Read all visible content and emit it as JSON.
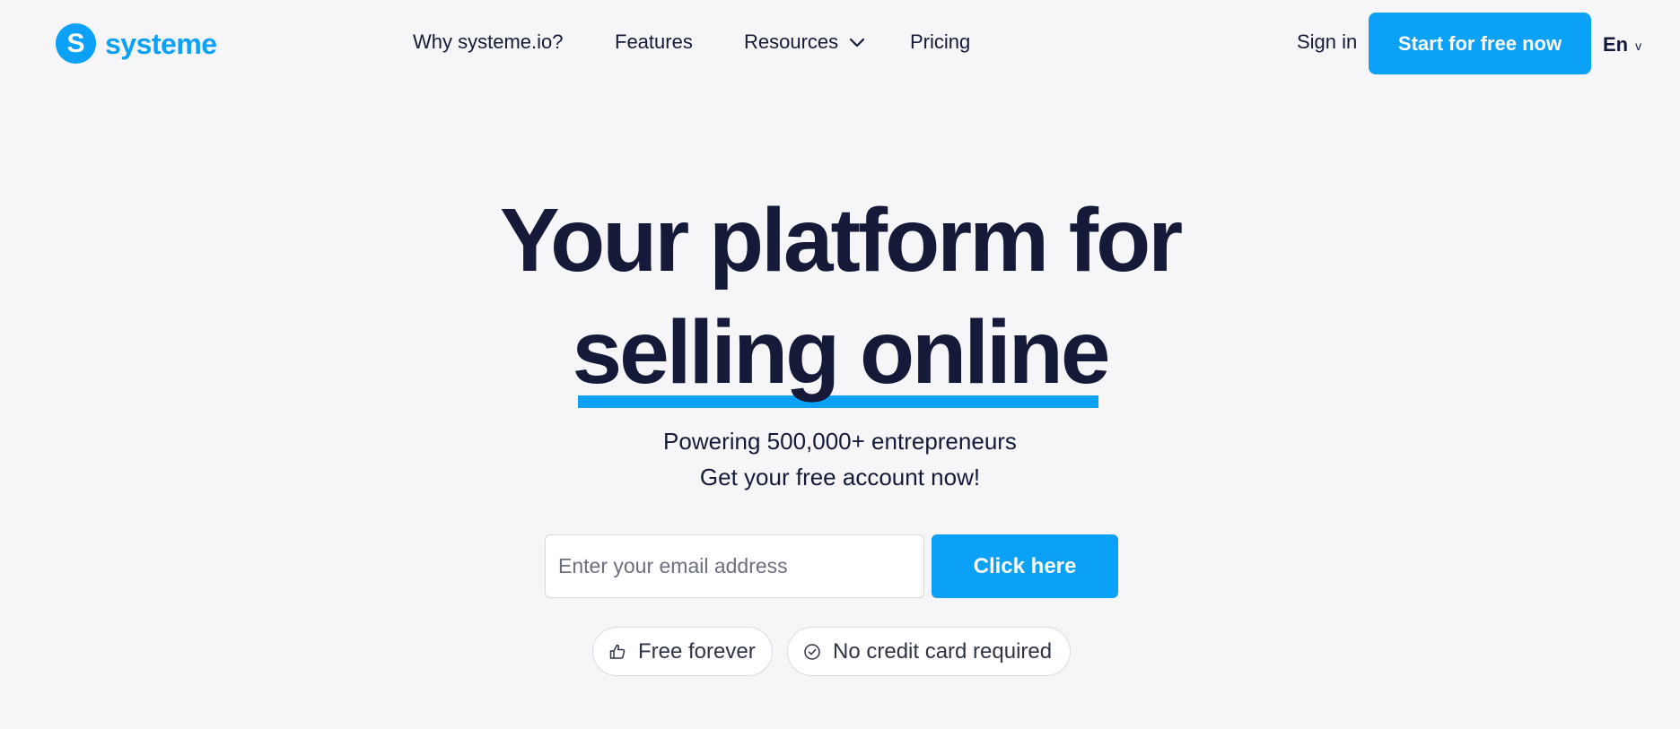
{
  "header": {
    "logo_letter": "S",
    "logo_text": "systeme",
    "nav": [
      {
        "label": "Why systeme.io?"
      },
      {
        "label": "Features"
      },
      {
        "label": "Resources",
        "has_dropdown": true
      },
      {
        "label": "Pricing"
      }
    ],
    "sign_in": "Sign in",
    "cta": "Start for free now",
    "language": "En",
    "language_caret": "v"
  },
  "hero": {
    "title_line1": "Your platform for",
    "title_line2": "selling online",
    "subtitle_line1": "Powering 500,000+ entrepreneurs",
    "subtitle_line2": "Get your free account now!",
    "email_placeholder": "Enter your email address",
    "email_value": "",
    "submit_label": "Click here",
    "badges": [
      {
        "icon": "thumbs-up-icon",
        "label": "Free forever"
      },
      {
        "icon": "check-circle-icon",
        "label": "No credit card required"
      }
    ]
  },
  "colors": {
    "accent": "#0ba1f7",
    "text": "#141a38",
    "background": "#f6f6f9"
  }
}
